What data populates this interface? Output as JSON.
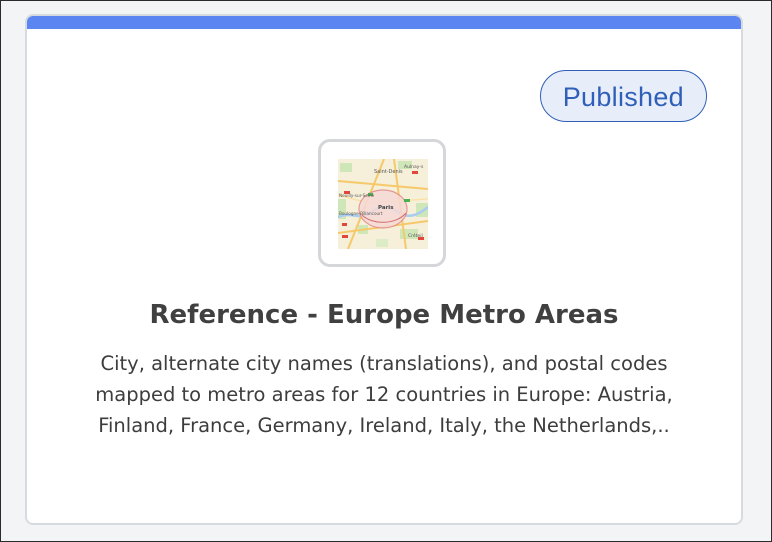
{
  "card": {
    "status": "Published",
    "title": "Reference - Europe Metro Areas",
    "description_lines": [
      "City, alternate city names (translations), and postal codes",
      "mapped to metro areas for 12 countries in Europe: Austria,",
      "Finland, France, Germany, Ireland, Italy, the Netherlands,.."
    ],
    "thumbnail": {
      "icon": "map-thumbnail-icon",
      "labels": {
        "city": "Paris",
        "north": "Saint-Denis",
        "northeast": "Aulnay-s",
        "west": "Neuilly-sur-Seine",
        "southwest": "Boulogne-Billancourt",
        "southeast": "Créteil"
      }
    },
    "colors": {
      "accent_bar": "#5b85f0",
      "badge_text": "#2f5fb8",
      "badge_bg": "#e8eef9"
    }
  }
}
